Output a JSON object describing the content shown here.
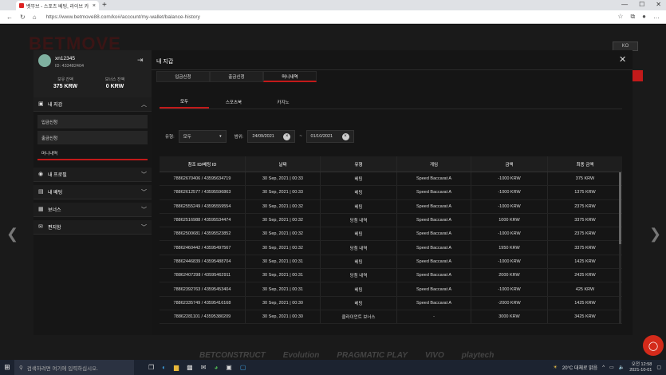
{
  "browser": {
    "tab_title": "벳무브 - 스포츠 베팅, 라이브 카",
    "url": "https://www.betmove88.com/ko#/account/my-wallet/balance-history"
  },
  "site": {
    "logo": "BETMOVE",
    "lang": "KO"
  },
  "user": {
    "name": "xn12345",
    "id": "ID: 433482404",
    "balance_label": "보유 잔액",
    "balance_value": "375 KRW",
    "bonus_label": "보너스 잔액",
    "bonus_value": "0 KRW"
  },
  "menu": {
    "wallet": "내 지갑",
    "deposit": "입금신청",
    "withdraw": "출금신청",
    "history": "머니내역",
    "profile": "내 프로필",
    "bets": "내 배팅",
    "bonus": "보너스",
    "messages": "편지함"
  },
  "modal": {
    "title": "내 지갑",
    "tabs": [
      "입금신청",
      "출금신청",
      "머니내역"
    ],
    "subtabs": [
      "모두",
      "스포츠북",
      "카지노"
    ]
  },
  "filters": {
    "type_label": "유형:",
    "type_value": "모두",
    "range_label": "범위:",
    "from": "24/09/2021",
    "to": "01/10/2021",
    "sep": "~"
  },
  "table": {
    "headers": [
      "참조 ID/베팅 ID",
      "날짜",
      "유형",
      "게임",
      "금액",
      "최종 금액"
    ],
    "rows": [
      [
        "78862670406 / 43595634719",
        "30 Sep, 2021 | 00:33",
        "베팅",
        "Speed Baccarat A",
        "-1000 KRW",
        "375 KRW"
      ],
      [
        "78862612577 / 43595596863",
        "30 Sep, 2021 | 00:33",
        "베팅",
        "Speed Baccarat A",
        "-1000 KRW",
        "1375 KRW"
      ],
      [
        "78862555249 / 43595559554",
        "30 Sep, 2021 | 00:32",
        "베팅",
        "Speed Baccarat A",
        "-1000 KRW",
        "2375 KRW"
      ],
      [
        "78862516988 / 43595534474",
        "30 Sep, 2021 | 00:32",
        "당첨 내역",
        "Speed Baccarat A",
        "1000 KRW",
        "3375 KRW"
      ],
      [
        "78862500681 / 43595523852",
        "30 Sep, 2021 | 00:32",
        "베팅",
        "Speed Baccarat A",
        "-1000 KRW",
        "2375 KRW"
      ],
      [
        "78862460442 / 43595497567",
        "30 Sep, 2021 | 00:32",
        "당첨 내역",
        "Speed Baccarat A",
        "1950 KRW",
        "3375 KRW"
      ],
      [
        "78862446839 / 43595488704",
        "30 Sep, 2021 | 00:31",
        "베팅",
        "Speed Baccarat A",
        "-1000 KRW",
        "1425 KRW"
      ],
      [
        "78862407298 / 43595462911",
        "30 Sep, 2021 | 00:31",
        "당첨 내역",
        "Speed Baccarat A",
        "2000 KRW",
        "2425 KRW"
      ],
      [
        "78862392763 / 43595453404",
        "30 Sep, 2021 | 00:31",
        "베팅",
        "Speed Baccarat A",
        "-1000 KRW",
        "425 KRW"
      ],
      [
        "78862335749 / 43595416168",
        "30 Sep, 2021 | 00:30",
        "베팅",
        "Speed Baccarat A",
        "-2000 KRW",
        "1425 KRW"
      ],
      [
        "78862281101 / 43595380209",
        "30 Sep, 2021 | 00:30",
        "클라이언트 보너스",
        "-",
        "3000 KRW",
        "3425 KRW"
      ]
    ]
  },
  "footer_logos": [
    "BETCONSTRUCT",
    "Evolution",
    "PRAGMATIC PLAY",
    "VIVO",
    "playtech"
  ],
  "taskbar": {
    "search_placeholder": "검색하려면 여기에 입력하십시오.",
    "weather": "20°C 대체로 맑음",
    "time": "오전 12:58",
    "date": "2021-10-01"
  }
}
